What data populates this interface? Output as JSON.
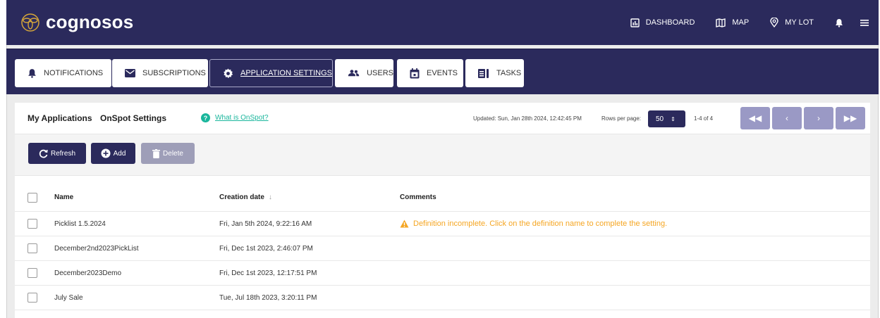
{
  "app": {
    "brand": "cognosos"
  },
  "topnav": {
    "dashboard_label": "DASHBOARD",
    "map_label": "MAP",
    "mylot_label": "MY LOT",
    "icons": [
      "dashboard-icon",
      "map-icon",
      "location-pin-icon",
      "bell-icon",
      "menu-icon"
    ]
  },
  "tabs": [
    {
      "label": "NOTIFICATIONS",
      "icon": "bell-icon"
    },
    {
      "label": "SUBSCRIPTIONS",
      "icon": "envelope-icon"
    },
    {
      "label": "APPLICATION SETTINGS",
      "icon": "gear-icon",
      "active": true
    },
    {
      "label": "USERS",
      "icon": "users-icon"
    },
    {
      "label": "EVENTS",
      "icon": "calendar-icon"
    },
    {
      "label": "TASKS",
      "icon": "tasks-icon"
    }
  ],
  "panel": {
    "title_my_apps": "My Applications",
    "title_onspot": "OnSpot Settings",
    "help_text": "What is OnSpot?",
    "help_glyph": "?",
    "updated": "Updated: Sun, Jan 28th 2024, 12:42:45 PM",
    "rows_label": "Rows per page:",
    "rows_value": "50",
    "range": "1-4 of 4",
    "pager": [
      "◀◀",
      "‹",
      "›",
      "▶▶"
    ]
  },
  "toolbar": {
    "refresh": "Refresh",
    "add": "Add",
    "delete": "Delete"
  },
  "table": {
    "headers": {
      "name": "Name",
      "date": "Creation date",
      "comments": "Comments",
      "sort_glyph": "↓"
    },
    "rows": [
      {
        "name": "Picklist 1.5.2024",
        "date": "Fri, Jan 5th 2024, 9:22:16 AM",
        "comment": "Definition incomplete. Click on the definition name to complete the setting."
      },
      {
        "name": "December2nd2023PickList",
        "date": "Fri, Dec 1st 2023, 2:46:07 PM",
        "comment": ""
      },
      {
        "name": "December2023Demo",
        "date": "Fri, Dec 1st 2023, 12:17:51 PM",
        "comment": ""
      },
      {
        "name": "July Sale",
        "date": "Tue, Jul 18th 2023, 3:20:11 PM",
        "comment": ""
      }
    ]
  },
  "colors": {
    "navy": "#2b2a5c",
    "accent": "#1ab69c",
    "warning": "#f5a623",
    "pager": "#9a99c5"
  }
}
